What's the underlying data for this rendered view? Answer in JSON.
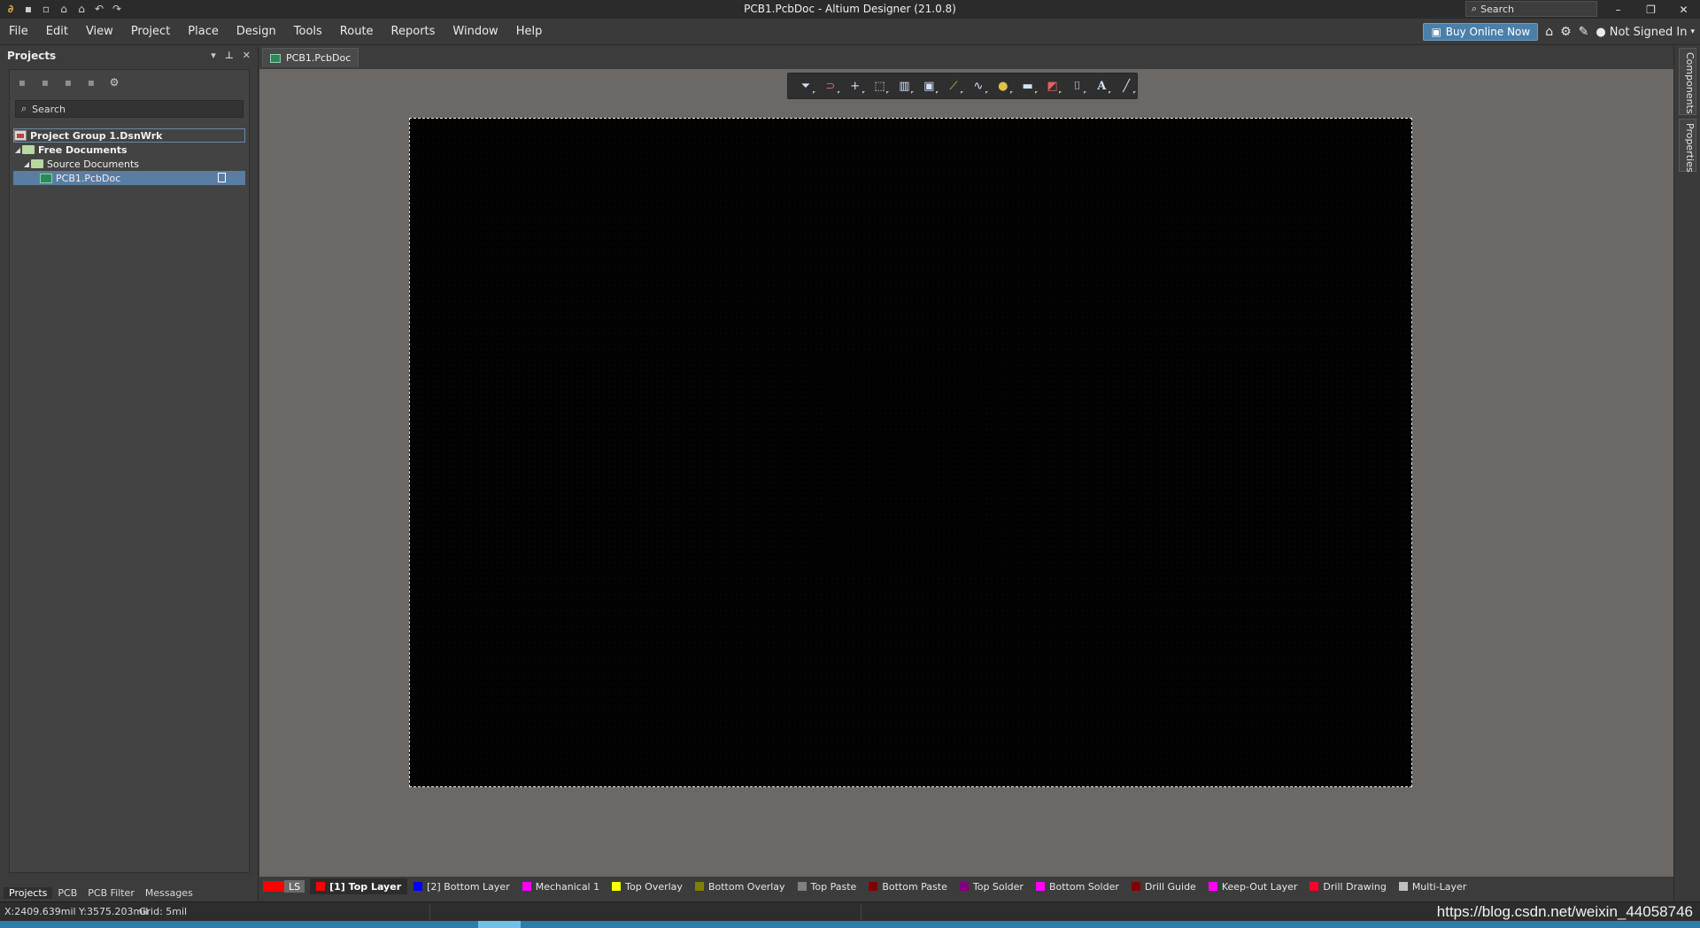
{
  "titlebar": {
    "title": "PCB1.PcbDoc - Altium Designer (21.0.8)",
    "search_placeholder": "Search",
    "minimize": "–",
    "restore": "❐",
    "close": "✕"
  },
  "menu": {
    "items": [
      "File",
      "Edit",
      "View",
      "Project",
      "Place",
      "Design",
      "Tools",
      "Route",
      "Reports",
      "Window",
      "Help"
    ]
  },
  "top_right": {
    "buy_label": "Buy Online Now",
    "signin_label": "Not Signed In"
  },
  "projects_panel": {
    "title": "Projects",
    "search_placeholder": "Search",
    "tree": {
      "group": "Project Group 1.DsnWrk",
      "free_docs": "Free Documents",
      "source_docs": "Source Documents",
      "pcb_doc": "PCB1.PcbDoc"
    },
    "tabs": [
      "Projects",
      "PCB",
      "PCB Filter",
      "Messages"
    ]
  },
  "document_tab": {
    "label": "PCB1.PcbDoc"
  },
  "right_panels": {
    "components": "Components",
    "properties": "Properties"
  },
  "layers": {
    "ls_label": "LS",
    "items": [
      {
        "label": "[1] Top Layer",
        "color": "#ff0000",
        "active": true
      },
      {
        "label": "[2] Bottom Layer",
        "color": "#0000ff"
      },
      {
        "label": "Mechanical 1",
        "color": "#ff00ff"
      },
      {
        "label": "Top Overlay",
        "color": "#ffff00"
      },
      {
        "label": "Bottom Overlay",
        "color": "#808000"
      },
      {
        "label": "Top Paste",
        "color": "#808080"
      },
      {
        "label": "Bottom Paste",
        "color": "#800000"
      },
      {
        "label": "Top Solder",
        "color": "#800080"
      },
      {
        "label": "Bottom Solder",
        "color": "#ff00ff"
      },
      {
        "label": "Drill Guide",
        "color": "#800000"
      },
      {
        "label": "Keep-Out Layer",
        "color": "#ff00ff"
      },
      {
        "label": "Drill Drawing",
        "color": "#ff002a"
      },
      {
        "label": "Multi-Layer",
        "color": "#c0c0c0"
      }
    ]
  },
  "status": {
    "coords": "X:2409.639mil Y:3575.203mil",
    "grid": "Grid: 5mil",
    "url": "https://blog.csdn.net/weixin_44058746"
  },
  "colors": {
    "board": "#020202",
    "workspace": "#6c6866",
    "accent": "#4a7faa"
  }
}
